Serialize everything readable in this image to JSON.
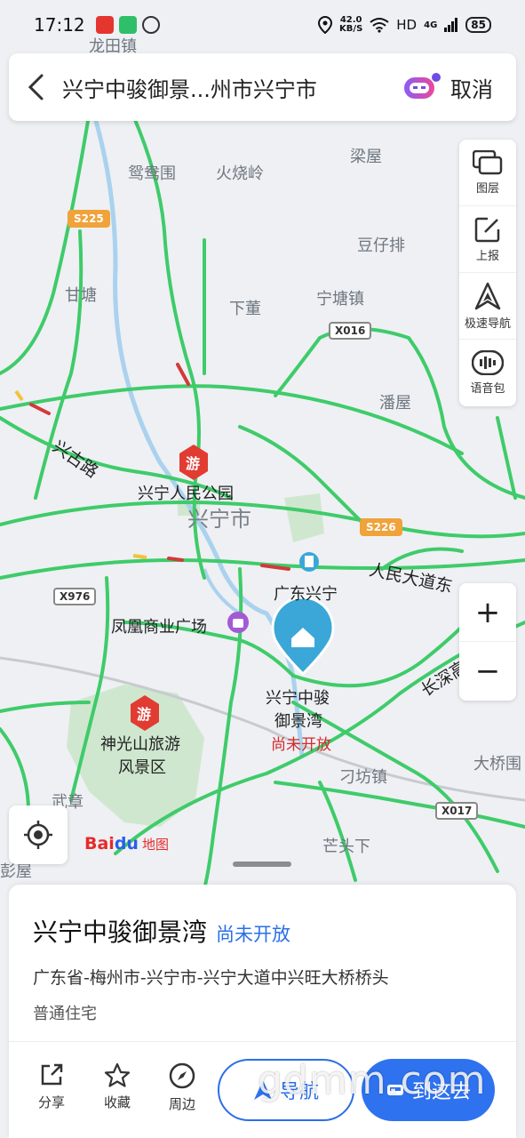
{
  "status_bar": {
    "time": "17:12",
    "net_speed_value": "42.0",
    "net_speed_unit": "KB/S",
    "hd": "HD",
    "network": "4G",
    "battery": "85"
  },
  "search": {
    "title": "兴宁中骏御景...州市兴宁市",
    "cancel_label": "取消"
  },
  "toolbar": {
    "layers_label": "图层",
    "report_label": "上报",
    "fast_nav_label": "极速导航",
    "voice_pack_label": "语音包"
  },
  "zoom": {
    "in_label": "+",
    "out_label": "−"
  },
  "map": {
    "city_label": "兴宁市",
    "places": [
      {
        "id": "longtian",
        "text": "龙田镇"
      },
      {
        "id": "yuanyangwei",
        "text": "鸳鸯围"
      },
      {
        "id": "huoshaoling",
        "text": "火烧岭"
      },
      {
        "id": "liangwu",
        "text": "梁屋"
      },
      {
        "id": "douzaipai",
        "text": "豆仔排"
      },
      {
        "id": "gantang",
        "text": "甘塘"
      },
      {
        "id": "xiadong",
        "text": "下董"
      },
      {
        "id": "ningtang",
        "text": "宁塘镇"
      },
      {
        "id": "panwu",
        "text": "潘屋"
      },
      {
        "id": "peoples_park",
        "text": "兴宁人民公园"
      },
      {
        "id": "fenghuang",
        "text": "凤凰商业广场"
      },
      {
        "id": "guangdong_xingning",
        "text": "广东兴宁"
      },
      {
        "id": "shenguangshan",
        "text": "神光山旅游"
      },
      {
        "id": "fengjingqu",
        "text": "风景区"
      },
      {
        "id": "wuzhang",
        "text": "武章"
      },
      {
        "id": "diaofang",
        "text": "刁坊镇"
      },
      {
        "id": "mangtouxia",
        "text": "芒头下"
      },
      {
        "id": "pengwu",
        "text": "彭屋"
      },
      {
        "id": "daqiaowei",
        "text": "大桥围"
      },
      {
        "id": "xingning_tag",
        "text": "兴宁中骏"
      },
      {
        "id": "yujingwan_tag",
        "text": "御景湾"
      },
      {
        "id": "not_open_tag",
        "text": "尚未开放"
      }
    ],
    "roads": [
      {
        "id": "s225",
        "text": "S225"
      },
      {
        "id": "x016",
        "text": "X016"
      },
      {
        "id": "s226",
        "text": "S226"
      },
      {
        "id": "x976",
        "text": "X976"
      },
      {
        "id": "x017",
        "text": "X017"
      },
      {
        "id": "xinggu",
        "text": "兴古路"
      },
      {
        "id": "renmin",
        "text": "人民大道东"
      },
      {
        "id": "changshen",
        "text": "长深高"
      }
    ],
    "poi_badge": "游"
  },
  "logo": {
    "bai": "Bai",
    "du": "du",
    "ditu": "地图"
  },
  "panel": {
    "title": "兴宁中骏御景湾",
    "status": "尚未开放",
    "address": "广东省-梅州市-兴宁市-兴宁大道中兴旺大桥桥头",
    "type": "普通住宅",
    "actions": {
      "share": "分享",
      "favorite": "收藏",
      "nearby": "周边",
      "navigate": "导航",
      "go_here": "到这去"
    }
  },
  "watermark": "gdmm.com",
  "colors": {
    "accent": "#2e72ef",
    "road_green": "#3fcb6a",
    "marker": "#3aa7d8"
  }
}
